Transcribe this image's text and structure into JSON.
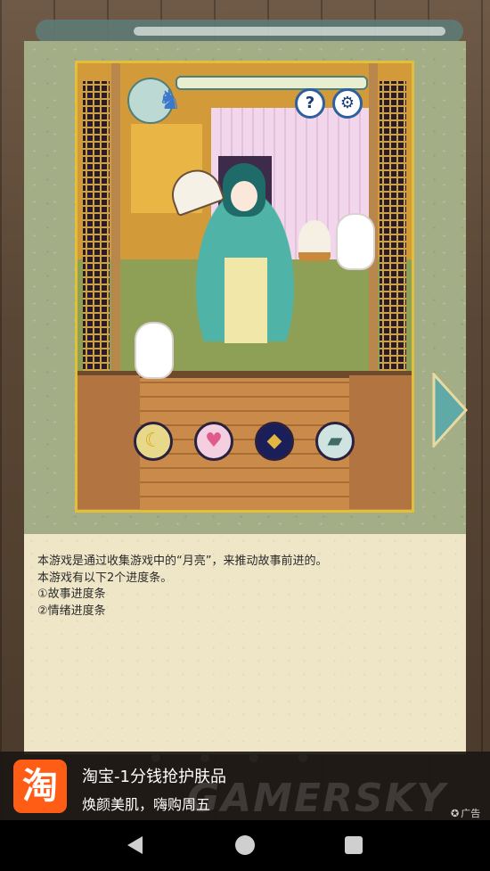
{
  "tutorial": {
    "lines": [
      "本游戏是通过收集游戏中的“月亮”，来推动故事前进的。",
      "本游戏有以下2个进度条。",
      "①故事进度条",
      "②情绪进度条"
    ]
  },
  "preview": {
    "help_glyph": "?",
    "settings_glyph": "⚙",
    "action_glyphs": [
      "☾",
      "♥",
      "◆",
      "▰"
    ]
  },
  "ad": {
    "logo_text": "淘",
    "title": "淘宝-1分钱抢护肤品",
    "subtitle": "焕颜美肌，嗨购周五",
    "label": "广告",
    "label_icon": "✪"
  },
  "watermark": "GAMERSKY",
  "colors": {
    "card_green": "#a3ae87",
    "card_paper": "#efe6c8",
    "frame_gold": "#e2bf3a",
    "ad_orange": "#ff5c16",
    "arrow_teal": "#5fa9a6"
  },
  "icons": {
    "next": "chevron-right-icon",
    "help": "question-icon",
    "settings": "gear-icon",
    "back": "back-triangle-icon",
    "home": "home-circle-icon",
    "recents": "recents-square-icon"
  }
}
